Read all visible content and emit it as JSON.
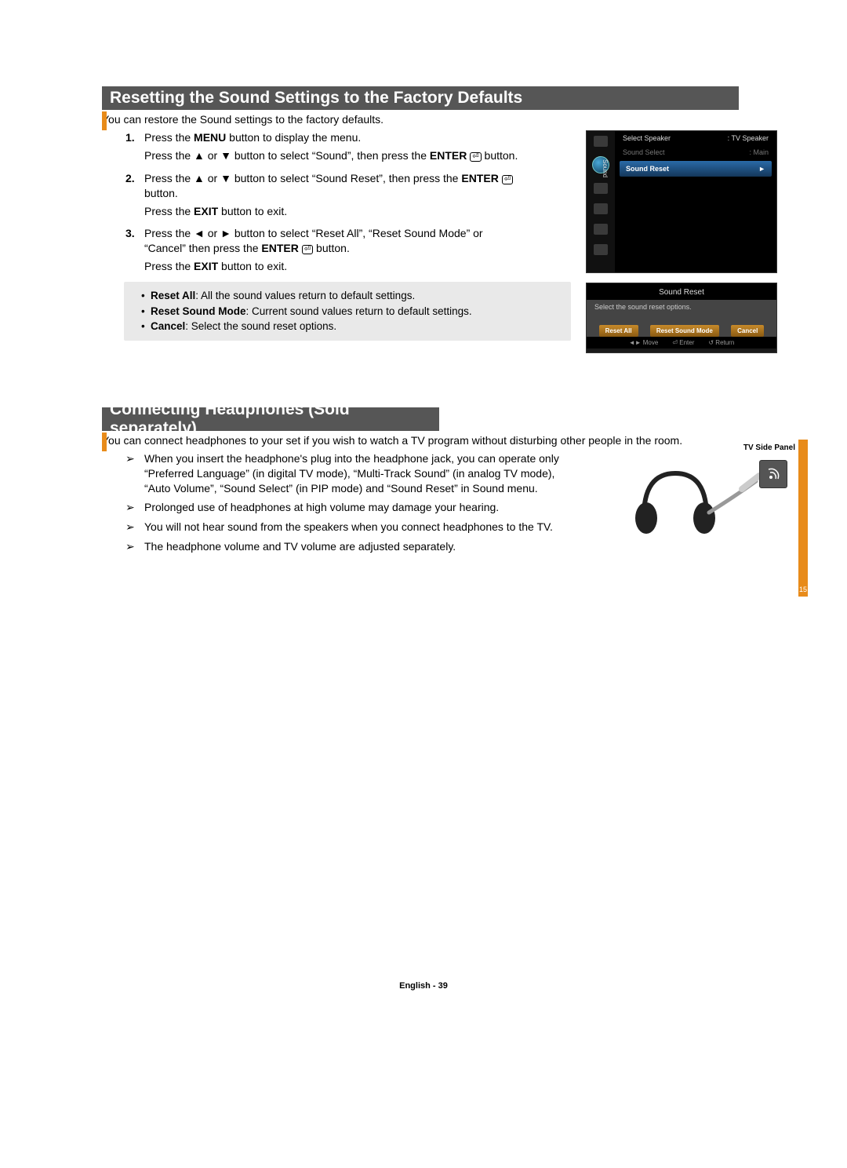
{
  "section1": {
    "heading": "Resetting the Sound Settings to the Factory Defaults",
    "intro": "You can restore the Sound settings to the factory defaults.",
    "steps": {
      "s1": {
        "num": "1.",
        "line1a": "Press the ",
        "menu": "MENU",
        "line1b": " button to display the menu.",
        "line2a": "Press the ▲ or ▼ button to select “Sound”, then press the ",
        "enter": "ENTER",
        "line2b": " button."
      },
      "s2": {
        "num": "2.",
        "line1a": "Press the ▲ or ▼ button to select “Sound Reset”, then press the ",
        "enter": "ENTER",
        "line1b": " button.",
        "line2a": "Press the ",
        "exit": "EXIT",
        "line2b": " button to exit."
      },
      "s3": {
        "num": "3.",
        "line1a": "Press the ◄ or ► button to select “Reset All”, “Reset Sound Mode” or “Cancel” then press the ",
        "enter": "ENTER",
        "line1b": " button.",
        "line2a": "Press the ",
        "exit": "EXIT",
        "line2b": " button to exit."
      }
    },
    "notes": {
      "n1_bold": "Reset All",
      "n1_rest": ": All the sound values return to default settings.",
      "n2_bold": "Reset Sound Mode",
      "n2_rest": ": Current sound values return to default settings.",
      "n3_bold": "Cancel",
      "n3_rest": ": Select the sound reset options."
    }
  },
  "osd1": {
    "sidebar_label": "Sound",
    "row1_l": "Select Speaker",
    "row1_r": ": TV Speaker",
    "row2_l": "Sound Select",
    "row2_r": ": Main",
    "row3_l": "Sound Reset",
    "row3_r": "►"
  },
  "osd2": {
    "title": "Sound Reset",
    "subtitle": "Select the sound reset options.",
    "btn1": "Reset All",
    "btn2": "Reset Sound Mode",
    "btn3": "Cancel",
    "f1": "◄► Move",
    "f2": "⏎ Enter",
    "f3": "↺ Return"
  },
  "section2": {
    "heading": "Connecting Headphones (Sold separately)",
    "intro": "You can connect headphones to your set if you wish to watch a TV program without disturbing other people in the room.",
    "panel_label": "TV Side Panel",
    "items": {
      "i1": "When you insert the headphone's plug into the headphone jack, you can operate only “Preferred Language” (in digital TV mode), “Multi-Track Sound” (in analog TV mode), “Auto Volume”, “Sound Select” (in PIP mode) and “Sound Reset” in Sound menu.",
      "i2": "Prolonged use of headphones at high volume may damage your hearing.",
      "i3": "You will not hear sound from the speakers when you connect headphones to the TV.",
      "i4": "The headphone volume and TV volume are adjusted separately."
    }
  },
  "strip_num": "15",
  "footer": "English - 39"
}
